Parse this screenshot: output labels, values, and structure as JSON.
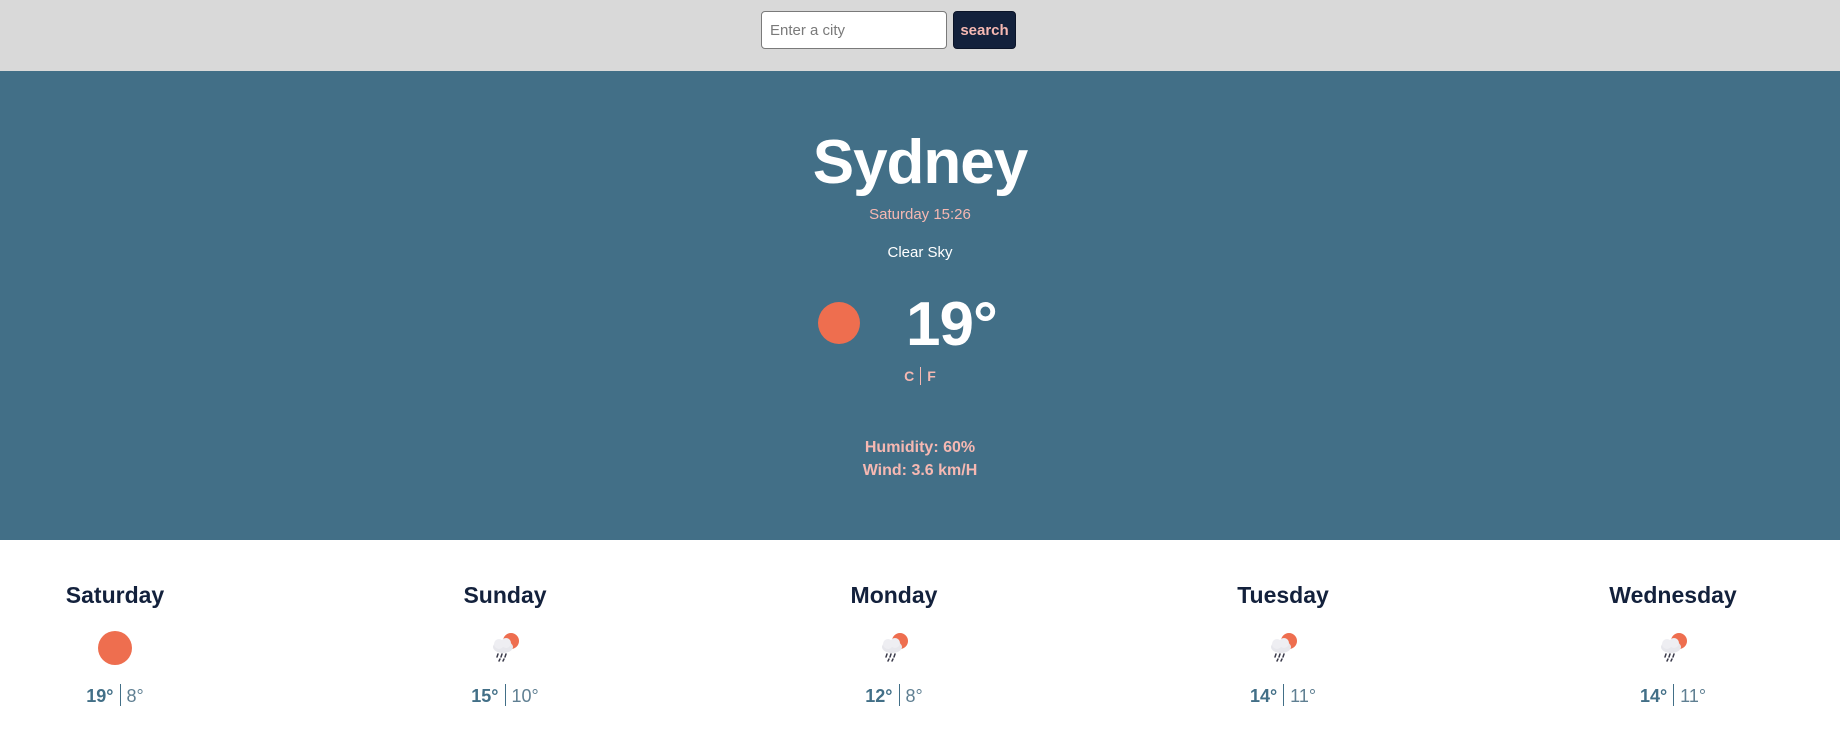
{
  "search": {
    "placeholder": "Enter a city",
    "button_label": "search"
  },
  "current": {
    "city": "Sydney",
    "datetime": "Saturday 15:26",
    "condition": "Clear Sky",
    "icon": "sun-icon",
    "temperature": "19°",
    "unit_c": "C",
    "unit_f": "F",
    "humidity": "Humidity: 60%",
    "wind": "Wind: 3.6 km/H"
  },
  "forecast": [
    {
      "day": "Saturday",
      "icon": "sun-icon",
      "max": "19°",
      "min": "8°"
    },
    {
      "day": "Sunday",
      "icon": "rain-cloud-sun-icon",
      "max": "15°",
      "min": "10°"
    },
    {
      "day": "Monday",
      "icon": "rain-cloud-sun-icon",
      "max": "12°",
      "min": "8°"
    },
    {
      "day": "Tuesday",
      "icon": "rain-cloud-sun-icon",
      "max": "14°",
      "min": "11°"
    },
    {
      "day": "Wednesday",
      "icon": "rain-cloud-sun-icon",
      "max": "14°",
      "min": "11°"
    }
  ],
  "colors": {
    "topbar": "#d9d9d9",
    "hero": "#426f87",
    "accent": "#f6b8b2",
    "sun": "#ee6e4f",
    "navy": "#13213c"
  }
}
